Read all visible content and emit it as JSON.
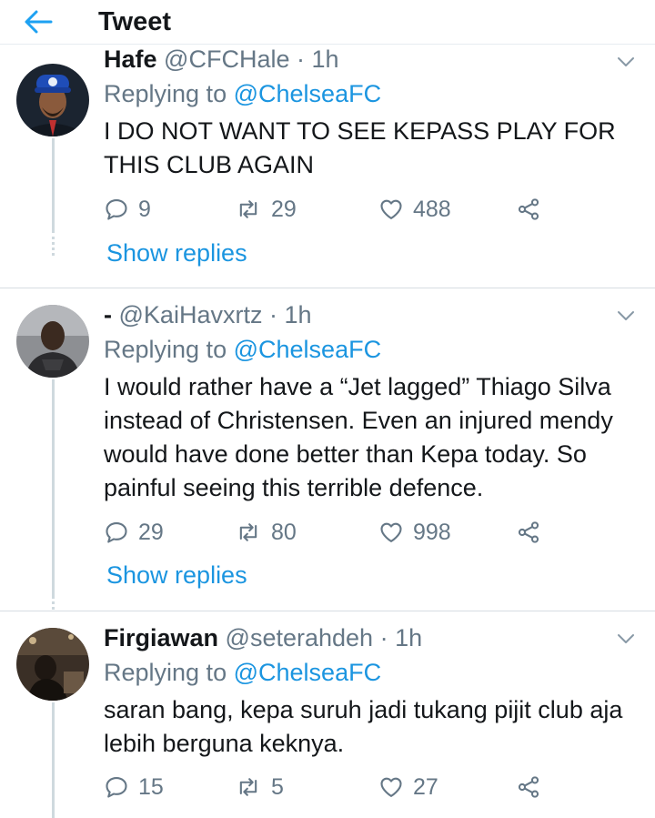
{
  "header": {
    "title": "Tweet"
  },
  "tweets": [
    {
      "display_name": "Hafe",
      "handle": "@CFCHale",
      "time": "· 1h",
      "replying_prefix": "Replying to",
      "replying_to": "@ChelseaFC",
      "text": "I DO NOT WANT TO SEE KEPASS PLAY FOR THIS CLUB AGAIN",
      "replies": "9",
      "retweets": "29",
      "likes": "488",
      "show_replies": "Show replies"
    },
    {
      "display_name": "-",
      "handle": "@KaiHavxrtz",
      "time": "· 1h",
      "replying_prefix": "Replying to",
      "replying_to": "@ChelseaFC",
      "text": "I would rather have a “Jet lagged” Thiago Silva instead of Christensen. Even an injured mendy would have done better than Kepa today. So painful seeing this terrible defence.",
      "replies": "29",
      "retweets": "80",
      "likes": "998",
      "show_replies": "Show replies"
    },
    {
      "display_name": "Firgiawan",
      "handle": "@seterahdeh",
      "time": "· 1h",
      "replying_prefix": "Replying to",
      "replying_to": "@ChelseaFC",
      "text": "saran bang, kepa suruh jadi tukang pijit club aja lebih berguna keknya.",
      "replies": "15",
      "retweets": "5",
      "likes": "27"
    }
  ]
}
